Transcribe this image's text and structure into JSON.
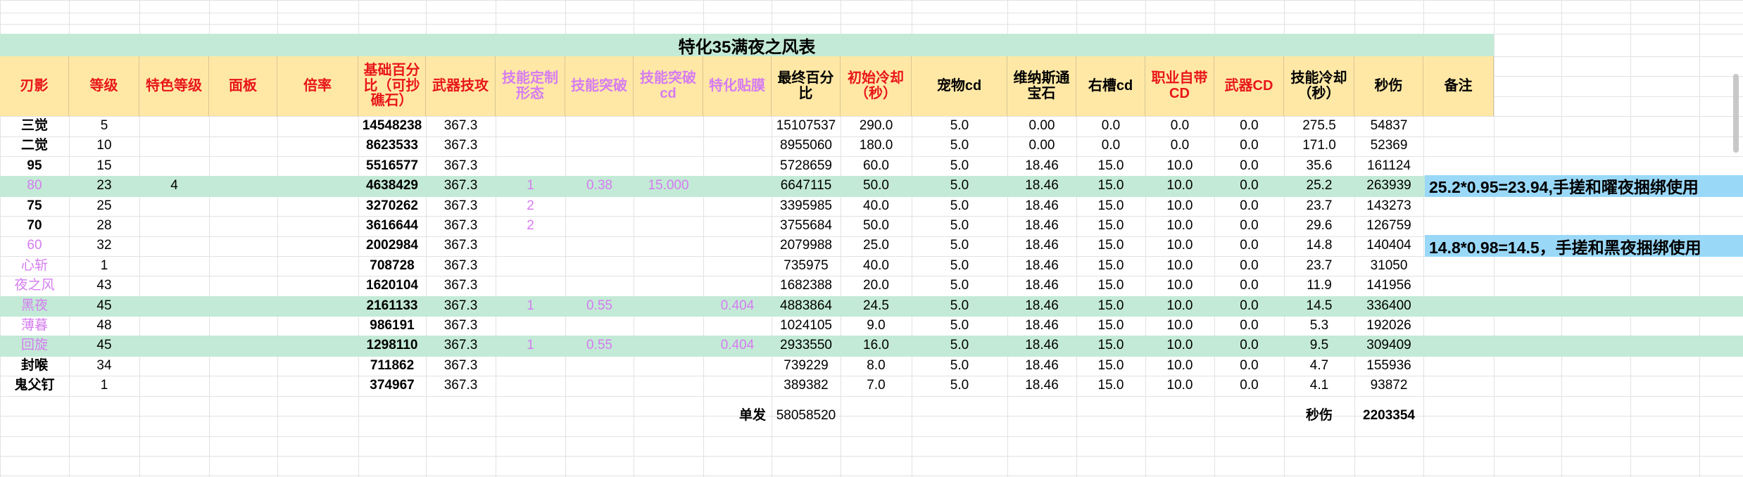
{
  "colors": {
    "green_band": "#c3ead6",
    "header_fill": "#ffe8a6",
    "header_red": "#e8161a",
    "header_purple": "#d57cf0",
    "note_blue": "#9ad8f8"
  },
  "sheet_title": "特化35满夜之风表",
  "headers": [
    {
      "text": "刃影",
      "tone": "red"
    },
    {
      "text": "等级",
      "tone": "red"
    },
    {
      "text": "特色等级",
      "tone": "red"
    },
    {
      "text": "面板",
      "tone": "red"
    },
    {
      "text": "倍率",
      "tone": "red"
    },
    {
      "text": "基础百分比（可抄礁石）",
      "tone": "red"
    },
    {
      "text": "武器技攻",
      "tone": "red"
    },
    {
      "text": "技能定制形态",
      "tone": "purple"
    },
    {
      "text": "技能突破",
      "tone": "purple"
    },
    {
      "text": "技能突破cd",
      "tone": "purple"
    },
    {
      "text": "特化贴膜",
      "tone": "purple"
    },
    {
      "text": "最终百分比",
      "tone": "black"
    },
    {
      "text": "初始冷却（秒）",
      "tone": "red"
    },
    {
      "text": "宠物cd",
      "tone": "black"
    },
    {
      "text": "维纳斯通宝石",
      "tone": "black"
    },
    {
      "text": "右槽cd",
      "tone": "black"
    },
    {
      "text": "职业自带CD",
      "tone": "red"
    },
    {
      "text": "武器CD",
      "tone": "red"
    },
    {
      "text": "技能冷却（秒）",
      "tone": "black"
    },
    {
      "text": "秒伤",
      "tone": "black"
    },
    {
      "text": "备注",
      "tone": "black"
    }
  ],
  "rows": [
    {
      "name": "三觉",
      "name_style": "bold",
      "level": "5",
      "spec": "",
      "base": "14548238",
      "wpn": "367.3",
      "form": "",
      "brk": "",
      "brkcd": "",
      "film": "",
      "final": "15107537",
      "cd0": "290.0",
      "pet": "5.0",
      "venus": "0.00",
      "right": "0.0",
      "job": "0.0",
      "wcd": "0.0",
      "cd": "275.5",
      "dps": "54837",
      "band": false
    },
    {
      "name": "二觉",
      "name_style": "bold",
      "level": "10",
      "spec": "",
      "base": "8623533",
      "wpn": "367.3",
      "form": "",
      "brk": "",
      "brkcd": "",
      "film": "",
      "final": "8955060",
      "cd0": "180.0",
      "pet": "5.0",
      "venus": "0.00",
      "right": "0.0",
      "job": "0.0",
      "wcd": "0.0",
      "cd": "171.0",
      "dps": "52369",
      "band": false
    },
    {
      "name": "95",
      "name_style": "bold",
      "level": "15",
      "spec": "",
      "base": "5516577",
      "wpn": "367.3",
      "form": "",
      "brk": "",
      "brkcd": "",
      "film": "",
      "final": "5728659",
      "cd0": "60.0",
      "pet": "5.0",
      "venus": "18.46",
      "right": "15.0",
      "job": "10.0",
      "wcd": "0.0",
      "cd": "35.6",
      "dps": "161124",
      "band": false
    },
    {
      "name": "80",
      "name_style": "purple",
      "level": "23",
      "spec": "4",
      "base": "4638429",
      "wpn": "367.3",
      "form": "1",
      "brk": "0.38",
      "brkcd": "15.000",
      "film": "",
      "final": "6647115",
      "cd0": "50.0",
      "pet": "5.0",
      "venus": "18.46",
      "right": "15.0",
      "job": "10.0",
      "wcd": "0.0",
      "cd": "25.2",
      "dps": "263939",
      "band": true
    },
    {
      "name": "75",
      "name_style": "bold",
      "level": "25",
      "spec": "",
      "base": "3270262",
      "wpn": "367.3",
      "form": "2",
      "brk": "",
      "brkcd": "",
      "film": "",
      "final": "3395985",
      "cd0": "40.0",
      "pet": "5.0",
      "venus": "18.46",
      "right": "15.0",
      "job": "10.0",
      "wcd": "0.0",
      "cd": "23.7",
      "dps": "143273",
      "band": false
    },
    {
      "name": "70",
      "name_style": "bold",
      "level": "28",
      "spec": "",
      "base": "3616644",
      "wpn": "367.3",
      "form": "2",
      "brk": "",
      "brkcd": "",
      "film": "",
      "final": "3755684",
      "cd0": "50.0",
      "pet": "5.0",
      "venus": "18.46",
      "right": "15.0",
      "job": "10.0",
      "wcd": "0.0",
      "cd": "29.6",
      "dps": "126759",
      "band": false
    },
    {
      "name": "60",
      "name_style": "purple",
      "level": "32",
      "spec": "",
      "base": "2002984",
      "wpn": "367.3",
      "form": "",
      "brk": "",
      "brkcd": "",
      "film": "",
      "final": "2079988",
      "cd0": "25.0",
      "pet": "5.0",
      "venus": "18.46",
      "right": "15.0",
      "job": "10.0",
      "wcd": "0.0",
      "cd": "14.8",
      "dps": "140404",
      "band": false
    },
    {
      "name": "心斩",
      "name_style": "purple",
      "level": "1",
      "spec": "",
      "base": "708728",
      "wpn": "367.3",
      "form": "",
      "brk": "",
      "brkcd": "",
      "film": "",
      "final": "735975",
      "cd0": "40.0",
      "pet": "5.0",
      "venus": "18.46",
      "right": "15.0",
      "job": "10.0",
      "wcd": "0.0",
      "cd": "23.7",
      "dps": "31050",
      "band": false
    },
    {
      "name": "夜之风",
      "name_style": "purple",
      "level": "43",
      "spec": "",
      "base": "1620104",
      "wpn": "367.3",
      "form": "",
      "brk": "",
      "brkcd": "",
      "film": "",
      "final": "1682388",
      "cd0": "20.0",
      "pet": "5.0",
      "venus": "18.46",
      "right": "15.0",
      "job": "10.0",
      "wcd": "0.0",
      "cd": "11.9",
      "dps": "141956",
      "band": false
    },
    {
      "name": "黑夜",
      "name_style": "purple",
      "level": "45",
      "spec": "",
      "base": "2161133",
      "wpn": "367.3",
      "form": "1",
      "brk": "0.55",
      "brkcd": "",
      "film": "0.404",
      "final": "4883864",
      "cd0": "24.5",
      "pet": "5.0",
      "venus": "18.46",
      "right": "15.0",
      "job": "10.0",
      "wcd": "0.0",
      "cd": "14.5",
      "dps": "336400",
      "band": true
    },
    {
      "name": "薄暮",
      "name_style": "purple",
      "level": "48",
      "spec": "",
      "base": "986191",
      "wpn": "367.3",
      "form": "",
      "brk": "",
      "brkcd": "",
      "film": "",
      "final": "1024105",
      "cd0": "9.0",
      "pet": "5.0",
      "venus": "18.46",
      "right": "15.0",
      "job": "10.0",
      "wcd": "0.0",
      "cd": "5.3",
      "dps": "192026",
      "band": false
    },
    {
      "name": "回旋",
      "name_style": "purple",
      "level": "45",
      "spec": "",
      "base": "1298110",
      "wpn": "367.3",
      "form": "1",
      "brk": "0.55",
      "brkcd": "",
      "film": "0.404",
      "final": "2933550",
      "cd0": "16.0",
      "pet": "5.0",
      "venus": "18.46",
      "right": "15.0",
      "job": "10.0",
      "wcd": "0.0",
      "cd": "9.5",
      "dps": "309409",
      "band": true
    },
    {
      "name": "封喉",
      "name_style": "bold",
      "level": "34",
      "spec": "",
      "base": "711862",
      "wpn": "367.3",
      "form": "",
      "brk": "",
      "brkcd": "",
      "film": "",
      "final": "739229",
      "cd0": "8.0",
      "pet": "5.0",
      "venus": "18.46",
      "right": "15.0",
      "job": "10.0",
      "wcd": "0.0",
      "cd": "4.7",
      "dps": "155936",
      "band": false
    },
    {
      "name": "鬼父钉",
      "name_style": "bold",
      "level": "1",
      "spec": "",
      "base": "374967",
      "wpn": "367.3",
      "form": "",
      "brk": "",
      "brkcd": "",
      "film": "",
      "final": "389382",
      "cd0": "7.0",
      "pet": "5.0",
      "venus": "18.46",
      "right": "15.0",
      "job": "10.0",
      "wcd": "0.0",
      "cd": "4.1",
      "dps": "93872",
      "band": false
    }
  ],
  "notes": [
    {
      "row_index": 3,
      "text": "25.2*0.95=23.94,手搓和曜夜捆绑使用"
    },
    {
      "row_index": 6,
      "text": "14.8*0.98=14.5，手搓和黑夜捆绑使用"
    }
  ],
  "summary": {
    "single_label": "单发",
    "single_value": "58058520",
    "dps_label": "秒伤",
    "dps_value": "2203354"
  }
}
